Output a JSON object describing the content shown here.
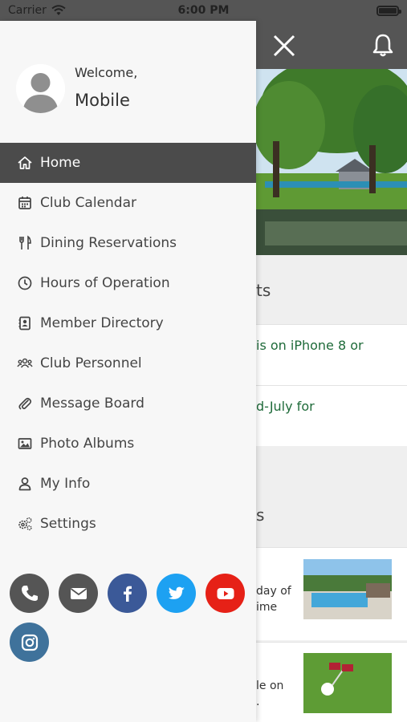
{
  "status_bar": {
    "carrier": "Carrier",
    "time": "6:00 PM"
  },
  "profile": {
    "welcome": "Welcome,",
    "name": "Mobile"
  },
  "menu": [
    {
      "label": "Home",
      "icon": "home-icon",
      "active": true
    },
    {
      "label": "Club Calendar",
      "icon": "calendar-icon",
      "active": false
    },
    {
      "label": "Dining Reservations",
      "icon": "utensils-icon",
      "active": false
    },
    {
      "label": "Hours of Operation",
      "icon": "clock-icon",
      "active": false
    },
    {
      "label": "Member Directory",
      "icon": "contact-card-icon",
      "active": false
    },
    {
      "label": "Club Personnel",
      "icon": "people-icon",
      "active": false
    },
    {
      "label": "Message Board",
      "icon": "paperclip-icon",
      "active": false
    },
    {
      "label": "Photo Albums",
      "icon": "image-icon",
      "active": false
    },
    {
      "label": "My Info",
      "icon": "user-icon",
      "active": false
    },
    {
      "label": "Settings",
      "icon": "gears-icon",
      "active": false
    }
  ],
  "social": [
    {
      "name": "phone-icon",
      "color": "#555555"
    },
    {
      "name": "email-icon",
      "color": "#555555"
    },
    {
      "name": "facebook-icon",
      "color": "#3b5998"
    },
    {
      "name": "twitter-icon",
      "color": "#1da1f2"
    },
    {
      "name": "youtube-icon",
      "color": "#e62117"
    },
    {
      "name": "instagram-icon",
      "color": "#3f729b"
    }
  ],
  "background": {
    "section1_heading": "ts",
    "items": [
      "is on iPhone 8 or",
      "d-July for"
    ],
    "section2_heading": "s",
    "news1_lines": [
      "day of",
      "ime"
    ],
    "news2_lines": [
      "le on",
      "."
    ]
  },
  "colors": {
    "active_bg": "#4b4b4b",
    "topbar": "#555555",
    "link_green": "#1f6b3a"
  }
}
